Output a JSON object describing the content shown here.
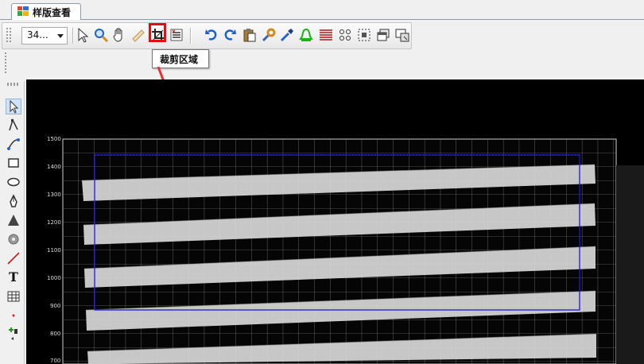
{
  "tab": {
    "title": "样版查看"
  },
  "toolbar": {
    "zoom_value": "34...",
    "icons": [
      "select-arrow-icon",
      "zoom-icon",
      "pan-hand-icon",
      "ruler-icon",
      "crop-icon",
      "list-edit-icon",
      "undo-icon",
      "redo-icon",
      "paste-icon",
      "wrench-icon",
      "eyedropper-icon",
      "warning-bell-icon",
      "lines-icon",
      "dots-grid-icon",
      "select-region-icon",
      "copy-window-icon",
      "screen-export-icon"
    ]
  },
  "tooltip": {
    "text": "裁剪区域"
  },
  "left_tools": [
    "pointer-icon",
    "node-edit-icon",
    "bezier-icon",
    "rectangle-icon",
    "ellipse-icon",
    "pen-icon",
    "triangle-icon",
    "circle-icon",
    "line-icon",
    "text-icon",
    "table-icon",
    "marker-icon",
    "connector-icon"
  ],
  "left_tools_text": {
    "text_tool": "T"
  },
  "chart": {
    "y_ticks": [
      "1500",
      "1400",
      "1300",
      "1200",
      "1100",
      "1000",
      "900",
      "800",
      "700"
    ]
  },
  "colors": {
    "highlight": "#e01010",
    "selection": "#1010c0",
    "canvas": "#000000"
  }
}
